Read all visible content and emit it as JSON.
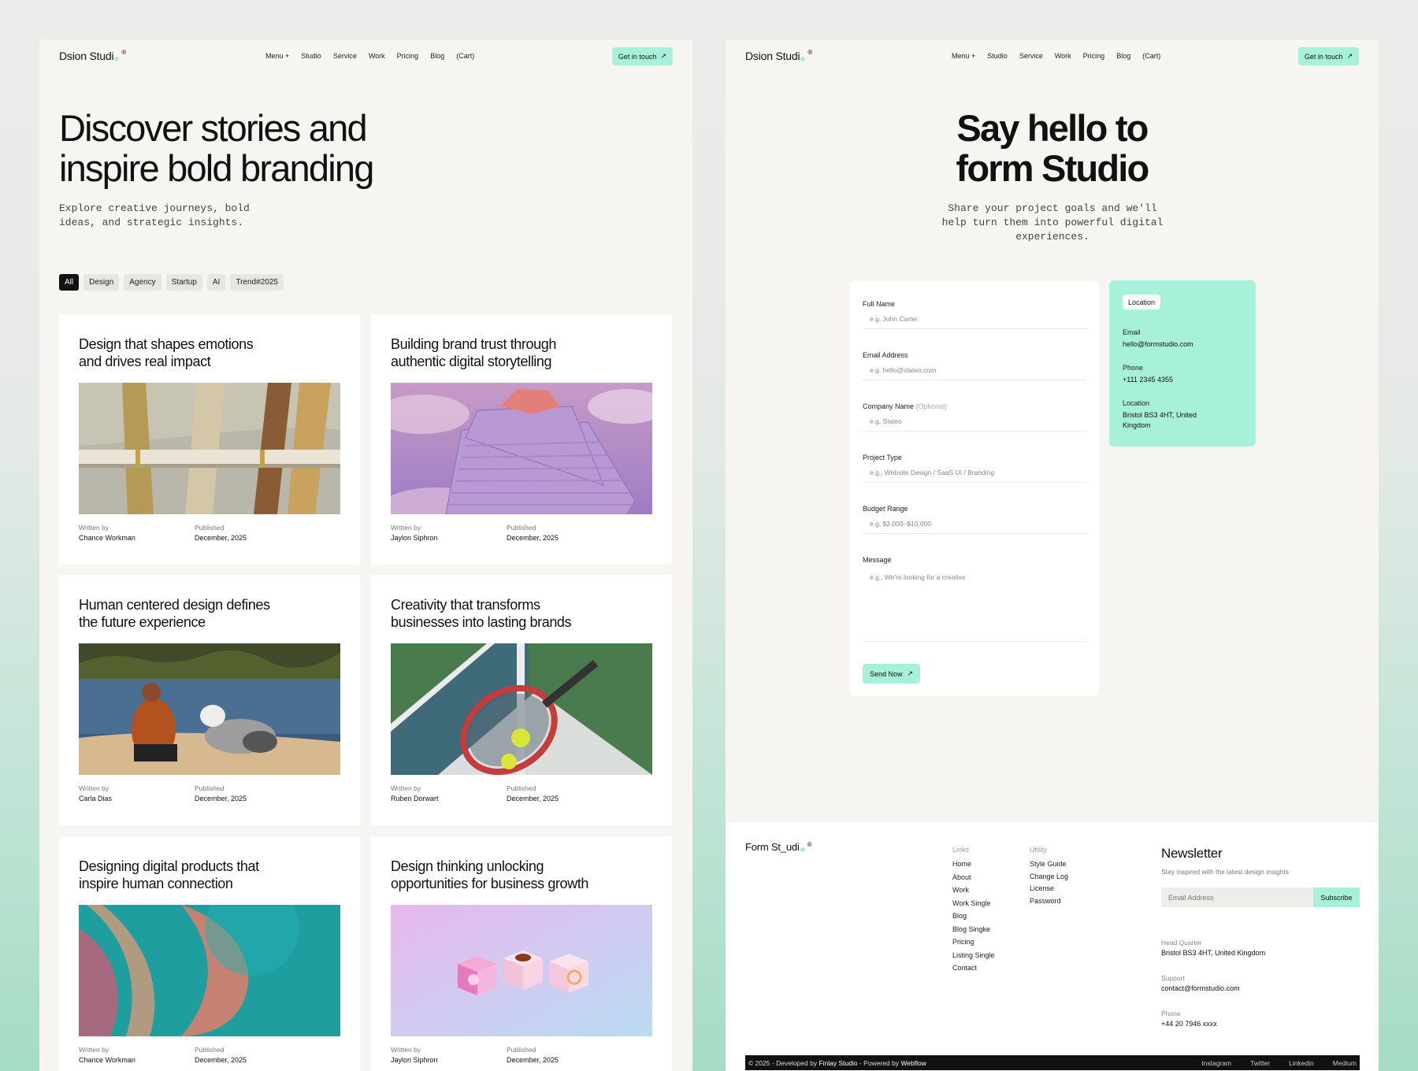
{
  "left": {
    "nav": {
      "logo": "Dsion Studi",
      "logo_mark": "®",
      "menu": [
        "Menu +",
        "Studio",
        "Service",
        "Work",
        "Pricing",
        "Blog",
        "(Cart)"
      ],
      "cta": "Get in touch"
    },
    "hero": {
      "title_line1": "Discover stories and",
      "title_line2": "inspire bold branding",
      "subtitle_line1": "Explore creative journeys, bold",
      "subtitle_line2": "ideas, and strategic insights."
    },
    "chips": [
      "All",
      "Design",
      "Agency",
      "Startup",
      "AI",
      "Trend#2025"
    ],
    "cards": [
      {
        "title_line1": "Design that shapes emotions",
        "title_line2": "and drives real impact",
        "written_label": "Written by",
        "author": "Chance Workman",
        "published_label": "Published",
        "date": "December, 2025"
      },
      {
        "title_line1": "Building brand trust through",
        "title_line2": "authentic digital storytelling",
        "written_label": "Written by",
        "author": "Jaylon Siphron",
        "published_label": "Published",
        "date": "December, 2025"
      },
      {
        "title_line1": "Human centered design defines",
        "title_line2": "the future experience",
        "written_label": "Written by",
        "author": "Carla Dias",
        "published_label": "Published",
        "date": "December, 2025"
      },
      {
        "title_line1": "Creativity that transforms",
        "title_line2": "businesses into lasting brands",
        "written_label": "Written by",
        "author": "Ruben Dorwart",
        "published_label": "Published",
        "date": "December, 2025"
      },
      {
        "title_line1": "Designing digital products that",
        "title_line2": "inspire human connection",
        "written_label": "Written by",
        "author": "Chance Workman",
        "published_label": "Published",
        "date": "December, 2025"
      },
      {
        "title_line1": "Design thinking unlocking",
        "title_line2": "opportunities for business growth",
        "written_label": "Written by",
        "author": "Jaylon Siphron",
        "published_label": "Published",
        "date": "December, 2025"
      }
    ]
  },
  "right": {
    "nav": {
      "logo": "Dsion Studi",
      "logo_mark": "®",
      "menu": [
        "Menu +",
        "Studio",
        "Service",
        "Work",
        "Pricing",
        "Blog",
        "(Cart)"
      ],
      "cta": "Get in touch"
    },
    "hero": {
      "title_line1": "Say hello to",
      "title_line2": "form Studio",
      "subtitle": "Share your project goals and we'll help turn them into powerful digital experiences."
    },
    "form": {
      "full_name_label": "Full Name",
      "full_name_placeholder": "e.g. John Carter",
      "email_label": "Email Address",
      "email_placeholder": "e.g. hello@slateo.com",
      "company_label": "Company Name",
      "company_optional": "(Optional)",
      "company_placeholder": "e.g. Slateo",
      "project_label": "Project Type",
      "project_placeholder": "e.g., Website Design / SaaS UI / Branding",
      "budget_label": "Budget Range",
      "budget_placeholder": "e.g. $3,000–$10,000",
      "message_label": "Message",
      "message_placeholder": "e.g., We're looking for a creative",
      "send": "Send Now"
    },
    "location_card": {
      "badge": "Location",
      "email_label": "Email",
      "email": "hello@formstudio.com",
      "phone_label": "Phone",
      "phone": "+111 2345 4355",
      "location_label": "Location",
      "location": "Bristol BS3 4HT, United Kingdom"
    },
    "footer": {
      "logo": "Form St_udi",
      "logo_mark": "®",
      "links_heading": "Links",
      "links": [
        "Home",
        "About",
        "Work",
        "Work Single",
        "Blog",
        "Blog Singke",
        "Pricing",
        "Listing Single",
        "Contact"
      ],
      "utility_heading": "Utility",
      "utility": [
        "Style Guide",
        "Change Log",
        "License",
        "Password"
      ],
      "newsletter_title": "Newsletter",
      "newsletter_sub": "Stay inspired with the latest design insights",
      "newsletter_placeholder": "Email Address",
      "subscribe": "Subscribe",
      "hq_label": "Head Quarter",
      "hq": "Bristol BS3 4HT, United Kingdom",
      "support_label": "Support",
      "support": "contact@formstudio.com",
      "phone_label": "Phone",
      "phone": "+44 20 7946 xxxx",
      "copyright_prefix": "© 2025 - Developed by",
      "developer": "Finlay Studio",
      "powered_prefix": "- Powered by",
      "powered": "Webflow",
      "social": [
        "Instagram",
        "Twitter",
        "Linkedin",
        "Medium"
      ]
    }
  },
  "colors": {
    "accent": "#a7f0d9",
    "panel": "#f6f5f2",
    "dark": "#111111"
  }
}
